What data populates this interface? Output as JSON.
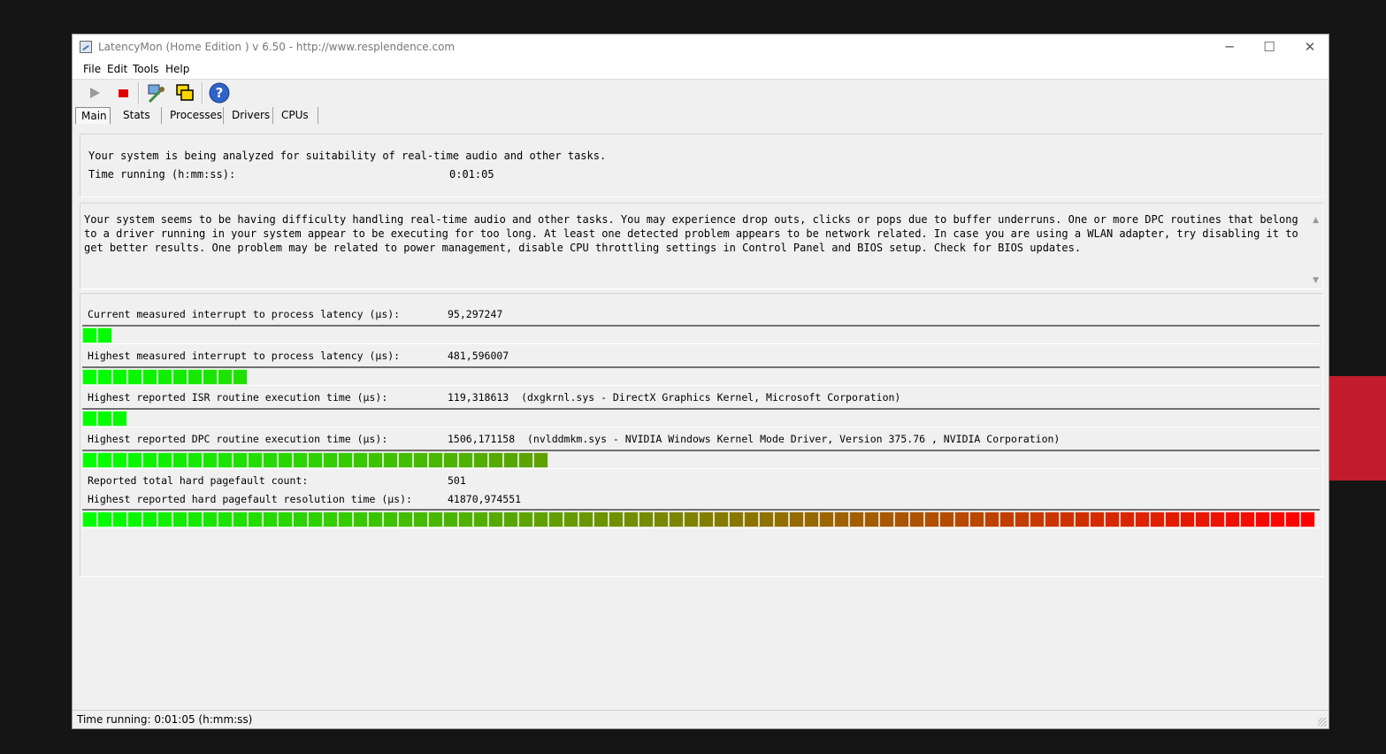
{
  "window": {
    "title": "LatencyMon  (Home Edition )  v 6.50 - http://www.resplendence.com",
    "minimize": "─",
    "maximize": "☐",
    "close": "✕"
  },
  "menu": [
    "File",
    "Edit",
    "Tools",
    "Help"
  ],
  "tabs": [
    "Main",
    "Stats",
    "Processes",
    "Drivers",
    "CPUs"
  ],
  "summary": {
    "status": "Your system is being analyzed for suitability of real-time audio and other tasks.",
    "time_label": "Time running (h:mm:ss):",
    "time_value": "0:01:05"
  },
  "advice": {
    "text": "Your system seems to be having difficulty handling real-time audio and other tasks. You may experience drop outs, clicks or pops due to buffer underruns. One or more DPC routines that belong to a driver running in your system appear to be executing for too long. At least one detected problem appears to be network related. In case you are using a WLAN adapter, try disabling it to get better results. One problem may be related to power management, disable CPU throttling settings in Control Panel and BIOS setup. Check for BIOS updates."
  },
  "metrics": [
    {
      "label": "Current measured interrupt to process latency (µs):",
      "value": "95,297247",
      "bar_fraction": 0.023
    },
    {
      "label": "Highest measured interrupt to process latency (µs):",
      "value": "481,596007",
      "bar_fraction": 0.133
    },
    {
      "label": "Highest reported ISR routine execution time (µs):",
      "value": "119,318613  (dxgkrnl.sys - DirectX Graphics Kernel, Microsoft Corporation)",
      "bar_fraction": 0.036
    },
    {
      "label": "Highest reported DPC routine execution time (µs):",
      "value": "1506,171158  (nvlddmkm.sys - NVIDIA Windows Kernel Mode Driver, Version 375.76 , NVIDIA Corporation)",
      "bar_fraction": 0.376
    },
    {
      "label": "Reported total hard pagefault count:",
      "value": "501"
    },
    {
      "label": "Highest reported hard pagefault resolution time (µs):",
      "value": "41870,974551",
      "bar_fraction": 1.0
    }
  ],
  "status_bar": "Time running: 0:01:05  (h:mm:ss)",
  "colors": {
    "bar_low": "#00ff00",
    "bar_mid": "#808000",
    "bar_high": "#ff0000",
    "desktop_accent": "#c21c2c"
  },
  "icons": [
    "play-icon",
    "stop-icon",
    "driver-tool-icon",
    "windows-icon",
    "help-icon"
  ]
}
